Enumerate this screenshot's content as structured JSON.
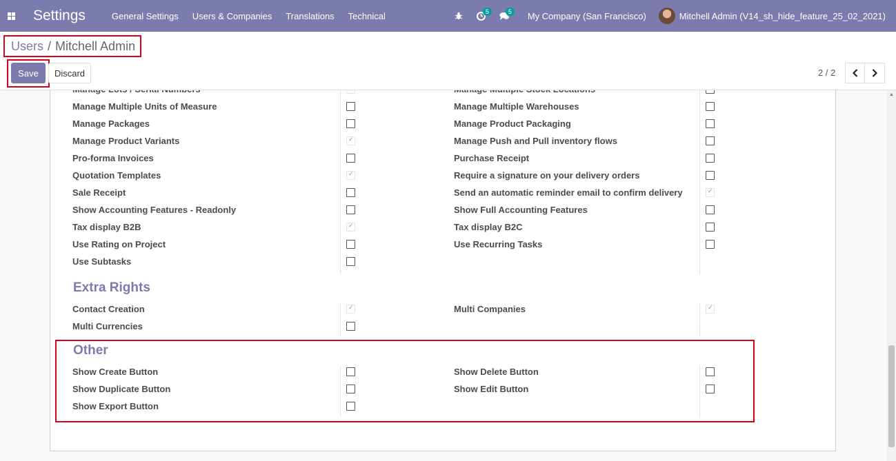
{
  "navbar": {
    "app_title": "Settings",
    "menu": [
      "General Settings",
      "Users & Companies",
      "Translations",
      "Technical"
    ],
    "activity_count": "5",
    "message_count": "5",
    "company": "My Company (San Francisco)",
    "user": "Mitchell Admin (V14_sh_hide_feature_25_02_2021)"
  },
  "breadcrumb": {
    "parent": "Users",
    "separator": "/",
    "current": "Mitchell Admin"
  },
  "buttons": {
    "save": "Save",
    "discard": "Discard"
  },
  "pager": {
    "value": "2 / 2"
  },
  "technical_rows": [
    {
      "left": "Manage Lots / Serial Numbers",
      "left_checked": true,
      "right": "Manage Multiple Stock Locations",
      "right_checked": false
    },
    {
      "left": "Manage Multiple Units of Measure",
      "left_checked": false,
      "right": "Manage Multiple Warehouses",
      "right_checked": false
    },
    {
      "left": "Manage Packages",
      "left_checked": false,
      "right": "Manage Product Packaging",
      "right_checked": false
    },
    {
      "left": "Manage Product Variants",
      "left_checked": true,
      "right": "Manage Push and Pull inventory flows",
      "right_checked": false
    },
    {
      "left": "Pro-forma Invoices",
      "left_checked": false,
      "right": "Purchase Receipt",
      "right_checked": false
    },
    {
      "left": "Quotation Templates",
      "left_checked": true,
      "right": "Require a signature on your delivery orders",
      "right_checked": false
    },
    {
      "left": "Sale Receipt",
      "left_checked": false,
      "right": "Send an automatic reminder email to confirm delivery",
      "right_checked": true
    },
    {
      "left": "Show Accounting Features - Readonly",
      "left_checked": false,
      "right": "Show Full Accounting Features",
      "right_checked": false
    },
    {
      "left": "Tax display B2B",
      "left_checked": true,
      "right": "Tax display B2C",
      "right_checked": false
    },
    {
      "left": "Use Rating on Project",
      "left_checked": false,
      "right": "Use Recurring Tasks",
      "right_checked": false
    },
    {
      "left": "Use Subtasks",
      "left_checked": false,
      "right": null,
      "right_checked": false
    }
  ],
  "extra_rights": {
    "title": "Extra Rights",
    "rows": [
      {
        "left": "Contact Creation",
        "left_checked": true,
        "right": "Multi Companies",
        "right_checked": true
      },
      {
        "left": "Multi Currencies",
        "left_checked": false,
        "right": null,
        "right_checked": false
      }
    ]
  },
  "other": {
    "title": "Other",
    "rows": [
      {
        "left": "Show Create Button",
        "left_checked": false,
        "right": "Show Delete Button",
        "right_checked": false
      },
      {
        "left": "Show Duplicate Button",
        "left_checked": false,
        "right": "Show Edit Button",
        "right_checked": false
      },
      {
        "left": "Show Export Button",
        "left_checked": false,
        "right": null,
        "right_checked": false
      }
    ]
  }
}
